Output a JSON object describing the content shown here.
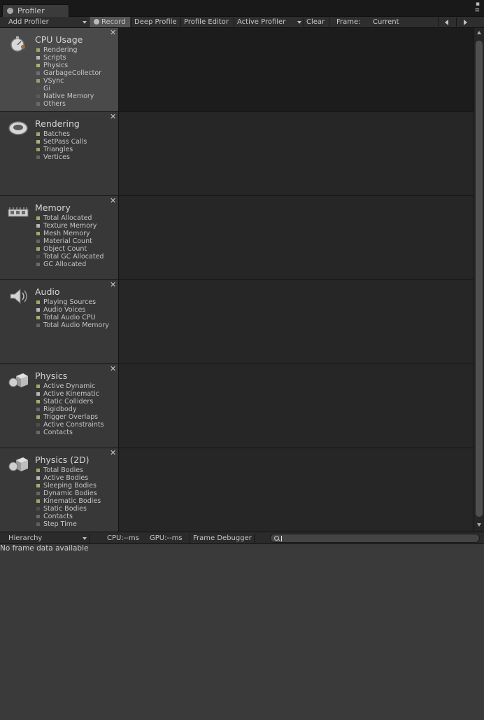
{
  "window": {
    "tab_title": "Profiler",
    "menu_glyph": "▪\n≡"
  },
  "toolbar": {
    "add_profiler": "Add Profiler",
    "record": "Record",
    "deep_profile": "Deep Profile",
    "profile_editor": "Profile Editor",
    "active_profiler": "Active Profiler",
    "clear": "Clear",
    "frame_label": "Frame:",
    "current": "Current"
  },
  "areas": [
    {
      "title": "CPU Usage",
      "icon": "cpu-stopwatch-icon",
      "selected": true,
      "legend": [
        {
          "label": "Rendering",
          "color": "#9fa56c"
        },
        {
          "label": "Scripts",
          "color": "#b8b8b8"
        },
        {
          "label": "Physics",
          "color": "#aeb06a"
        },
        {
          "label": "GarbageCollector",
          "color": "#6f6f6f"
        },
        {
          "label": "VSync",
          "color": "#9a9d72"
        },
        {
          "label": "Gi",
          "color": "#4f4f4f"
        },
        {
          "label": "Native Memory",
          "color": "#5c5c5c"
        },
        {
          "label": "Others",
          "color": "#6a6a6a"
        }
      ]
    },
    {
      "title": "Rendering",
      "icon": "rendering-ring-icon",
      "selected": false,
      "legend": [
        {
          "label": "Batches",
          "color": "#a4a86e"
        },
        {
          "label": "SetPass Calls",
          "color": "#b1b27a"
        },
        {
          "label": "Triangles",
          "color": "#9ea061"
        },
        {
          "label": "Vertices",
          "color": "#636363"
        }
      ]
    },
    {
      "title": "Memory",
      "icon": "memory-chip-icon",
      "selected": false,
      "legend": [
        {
          "label": "Total Allocated",
          "color": "#a7a86b"
        },
        {
          "label": "Texture Memory",
          "color": "#b5b5b5"
        },
        {
          "label": "Mesh Memory",
          "color": "#a4a768"
        },
        {
          "label": "Material Count",
          "color": "#666666"
        },
        {
          "label": "Object Count",
          "color": "#a1a36c"
        },
        {
          "label": "Total GC Allocated",
          "color": "#4f4f4f"
        },
        {
          "label": "GC Allocated",
          "color": "#6b6b6b"
        }
      ]
    },
    {
      "title": "Audio",
      "icon": "audio-speaker-icon",
      "selected": false,
      "legend": [
        {
          "label": "Playing Sources",
          "color": "#a3a66b"
        },
        {
          "label": "Audio Voices",
          "color": "#b7b7b7"
        },
        {
          "label": "Total Audio CPU",
          "color": "#aaac6a"
        },
        {
          "label": "Total Audio Memory",
          "color": "#646464"
        }
      ]
    },
    {
      "title": "Physics",
      "icon": "physics-shapes-icon",
      "selected": false,
      "legend": [
        {
          "label": "Active Dynamic",
          "color": "#a4a76b"
        },
        {
          "label": "Active Kinematic",
          "color": "#b6b6b6"
        },
        {
          "label": "Static Colliders",
          "color": "#a9ab6a"
        },
        {
          "label": "Rigidbody",
          "color": "#656565"
        },
        {
          "label": "Trigger Overlaps",
          "color": "#a0a36d"
        },
        {
          "label": "Active Constraints",
          "color": "#4f4f4f"
        },
        {
          "label": "Contacts",
          "color": "#696969"
        }
      ]
    },
    {
      "title": "Physics (2D)",
      "icon": "physics2d-shapes-icon",
      "selected": false,
      "legend": [
        {
          "label": "Total Bodies",
          "color": "#a4a76b"
        },
        {
          "label": "Active Bodies",
          "color": "#b6b6b6"
        },
        {
          "label": "Sleeping Bodies",
          "color": "#a9ab6a"
        },
        {
          "label": "Dynamic Bodies",
          "color": "#656565"
        },
        {
          "label": "Kinematic Bodies",
          "color": "#a0a36d"
        },
        {
          "label": "Static Bodies",
          "color": "#4f4f4f"
        },
        {
          "label": "Contacts",
          "color": "#696969"
        },
        {
          "label": "Step Time",
          "color": "#5f5f5f"
        }
      ]
    }
  ],
  "detail": {
    "view_mode": "Hierarchy",
    "cpu": "CPU:--ms",
    "gpu": "GPU:--ms",
    "frame_debugger": "Frame Debugger",
    "empty_message": "No frame data available"
  }
}
